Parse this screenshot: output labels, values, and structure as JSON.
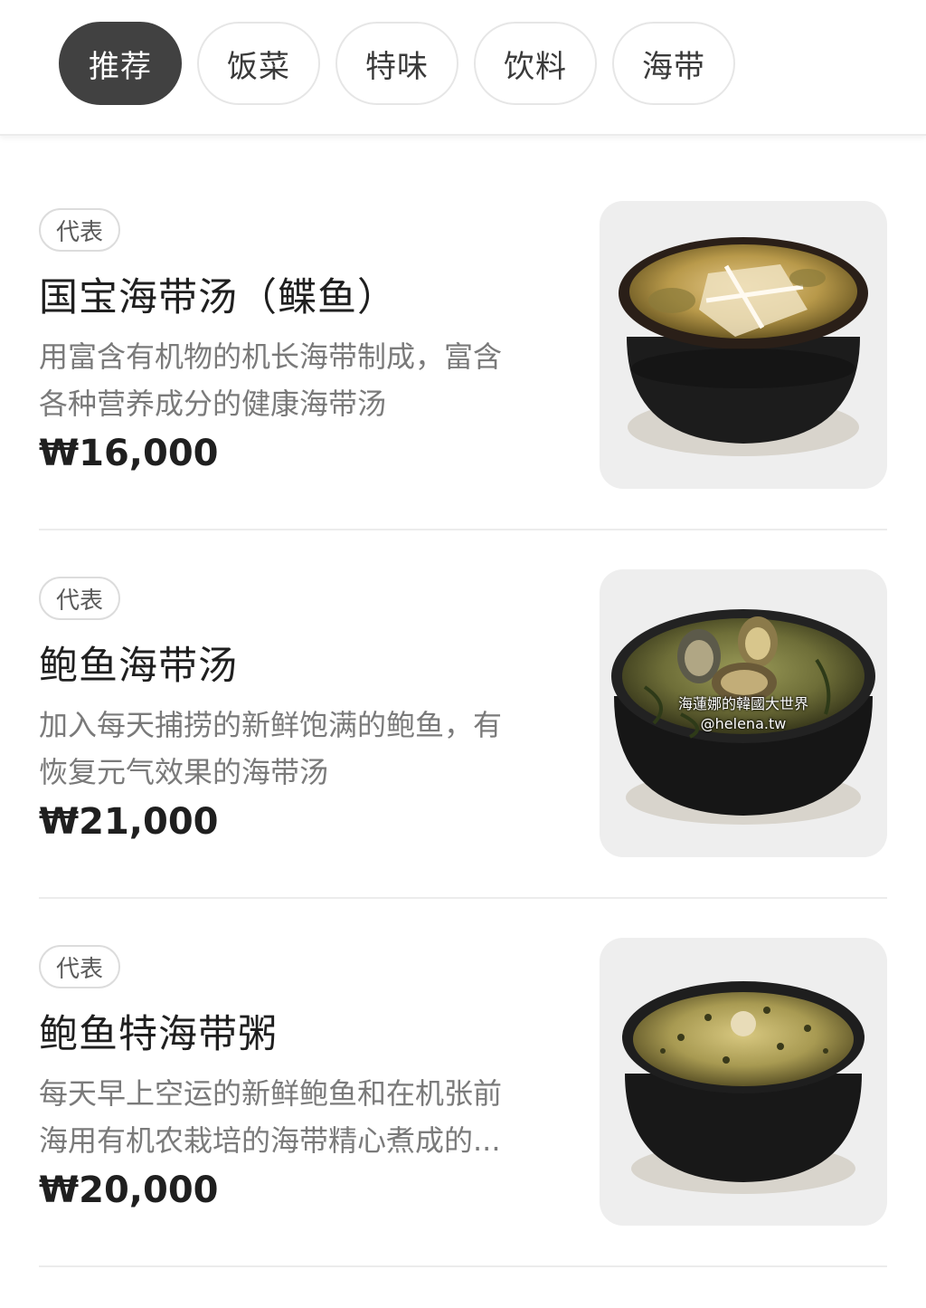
{
  "tabs": [
    {
      "label": "推荐",
      "active": true
    },
    {
      "label": "饭菜",
      "active": false
    },
    {
      "label": "特味",
      "active": false
    },
    {
      "label": "饮料",
      "active": false
    },
    {
      "label": "海带",
      "active": false
    }
  ],
  "items": [
    {
      "badge": "代表",
      "name": "国宝海带汤（鲽鱼）",
      "desc_line1": "用富含有机物的机长海带制成，富含",
      "desc_line2": "各种营养成分的健康海带汤",
      "price": "₩16,000",
      "image_icon": "seaweed-soup-flatfish-photo"
    },
    {
      "badge": "代表",
      "name": "鲍鱼海带汤",
      "desc_line1": "加入每天捕捞的新鲜饱满的鲍鱼，有",
      "desc_line2": "恢复元气效果的海带汤",
      "price": "₩21,000",
      "image_icon": "abalone-seaweed-soup-photo",
      "watermark_line1": "海蓮娜的韓國大世界",
      "watermark_line2": "@helena.tw"
    },
    {
      "badge": "代表",
      "name": "鲍鱼特海带粥",
      "desc_line1": "每天早上空运的新鲜鲍鱼和在机张前",
      "desc_line2": "海用有机农栽培的海带精心煮成的...",
      "price": "₩20,000",
      "image_icon": "abalone-seaweed-porridge-photo"
    }
  ],
  "colors": {
    "active_tab_bg": "#414141",
    "tab_border": "#e6e6e6",
    "badge_border": "#dcdcdc",
    "desc_text": "#7a7a7a",
    "photo_bg": "#eeeeee"
  }
}
